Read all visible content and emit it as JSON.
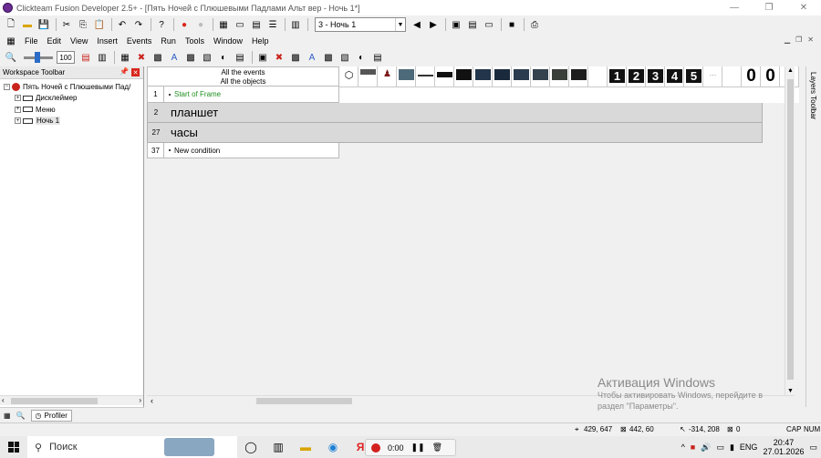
{
  "window": {
    "title": "Clickteam Fusion Developer 2.5+ - [Пять Ночей с Плюшевыми Падлами Альт вер - Ночь 1*]",
    "btn_min": "—",
    "btn_max": "❐",
    "btn_close": "✕"
  },
  "toolbar1": {
    "frame_select_value": "3 - Ночь 1"
  },
  "menu": {
    "items": [
      "File",
      "Edit",
      "View",
      "Insert",
      "Events",
      "Run",
      "Tools",
      "Window",
      "Help"
    ]
  },
  "toolbar3": {
    "zoom_value": "100"
  },
  "workspace": {
    "header": "Workspace Toolbar",
    "root": "Пять Ночей с Плюшевыми Пад/",
    "frames": [
      "Дисклеймер",
      "Меню",
      "Ночь 1"
    ],
    "profiler_tab": "Profiler"
  },
  "event_editor": {
    "header_line1": "All the events",
    "header_line2": "All the objects",
    "rows": [
      {
        "num": "1",
        "text": "Start of Frame"
      },
      {
        "num": "2",
        "text": "планшет"
      },
      {
        "num": "27",
        "text": "часы"
      },
      {
        "num": "37",
        "text": "New condition"
      }
    ],
    "object_numbers": [
      "1",
      "2",
      "3",
      "4",
      "5"
    ],
    "zero_digits": [
      "0",
      "0",
      "0"
    ]
  },
  "layers_toolbar": "Layers Toolbar",
  "watermark": {
    "title": "Активация Windows",
    "line1": "Чтобы активировать Windows, перейдите в",
    "line2": "раздел \"Параметры\"."
  },
  "status": {
    "coords1": "429, 647",
    "coords2": "442, 60",
    "coords3": "-314, 208",
    "coords4": "0",
    "cap": "CAP",
    "num": "NUM"
  },
  "taskbar": {
    "search": "Поиск",
    "recording_time": "0:00",
    "lang": "ENG",
    "time": "20:47",
    "date": "27.01.2026"
  }
}
